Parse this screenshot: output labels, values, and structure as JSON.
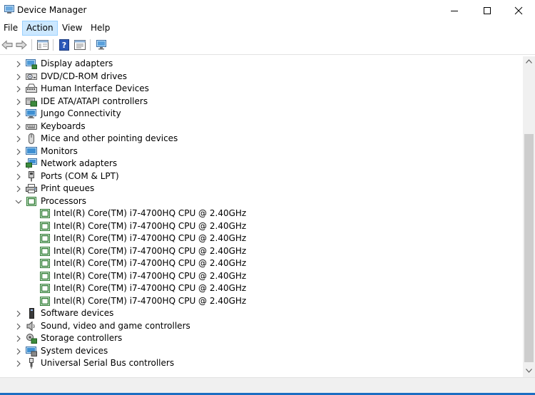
{
  "window": {
    "title": "Device Manager"
  },
  "menu": {
    "file": "File",
    "action": "Action",
    "view": "View",
    "help": "Help"
  },
  "colors": {
    "accent": "#1b6ec2",
    "menu_active_bg": "#cce8ff",
    "cpu_icon": "#2e7d32"
  },
  "tree": {
    "before_processors": [
      {
        "label": "Display adapters",
        "icon": "display-adapter-icon"
      },
      {
        "label": "DVD/CD-ROM drives",
        "icon": "dvd-drive-icon"
      },
      {
        "label": "Human Interface Devices",
        "icon": "hid-icon"
      },
      {
        "label": "IDE ATA/ATAPI controllers",
        "icon": "ide-controller-icon"
      },
      {
        "label": "Jungo Connectivity",
        "icon": "jungo-icon"
      },
      {
        "label": "Keyboards",
        "icon": "keyboard-icon"
      },
      {
        "label": "Mice and other pointing devices",
        "icon": "mouse-icon"
      },
      {
        "label": "Monitors",
        "icon": "monitor-icon"
      },
      {
        "label": "Network adapters",
        "icon": "network-adapter-icon"
      },
      {
        "label": "Ports (COM & LPT)",
        "icon": "port-icon"
      },
      {
        "label": "Print queues",
        "icon": "printer-icon"
      }
    ],
    "processors": {
      "label": "Processors",
      "expanded": true,
      "children": [
        "Intel(R) Core(TM) i7-4700HQ CPU @ 2.40GHz",
        "Intel(R) Core(TM) i7-4700HQ CPU @ 2.40GHz",
        "Intel(R) Core(TM) i7-4700HQ CPU @ 2.40GHz",
        "Intel(R) Core(TM) i7-4700HQ CPU @ 2.40GHz",
        "Intel(R) Core(TM) i7-4700HQ CPU @ 2.40GHz",
        "Intel(R) Core(TM) i7-4700HQ CPU @ 2.40GHz",
        "Intel(R) Core(TM) i7-4700HQ CPU @ 2.40GHz",
        "Intel(R) Core(TM) i7-4700HQ CPU @ 2.40GHz"
      ]
    },
    "after_processors": [
      {
        "label": "Software devices",
        "icon": "software-device-icon"
      },
      {
        "label": "Sound, video and game controllers",
        "icon": "speaker-icon"
      },
      {
        "label": "Storage controllers",
        "icon": "storage-controller-icon"
      },
      {
        "label": "System devices",
        "icon": "system-device-icon"
      },
      {
        "label": "Universal Serial Bus controllers",
        "icon": "usb-icon"
      }
    ]
  }
}
